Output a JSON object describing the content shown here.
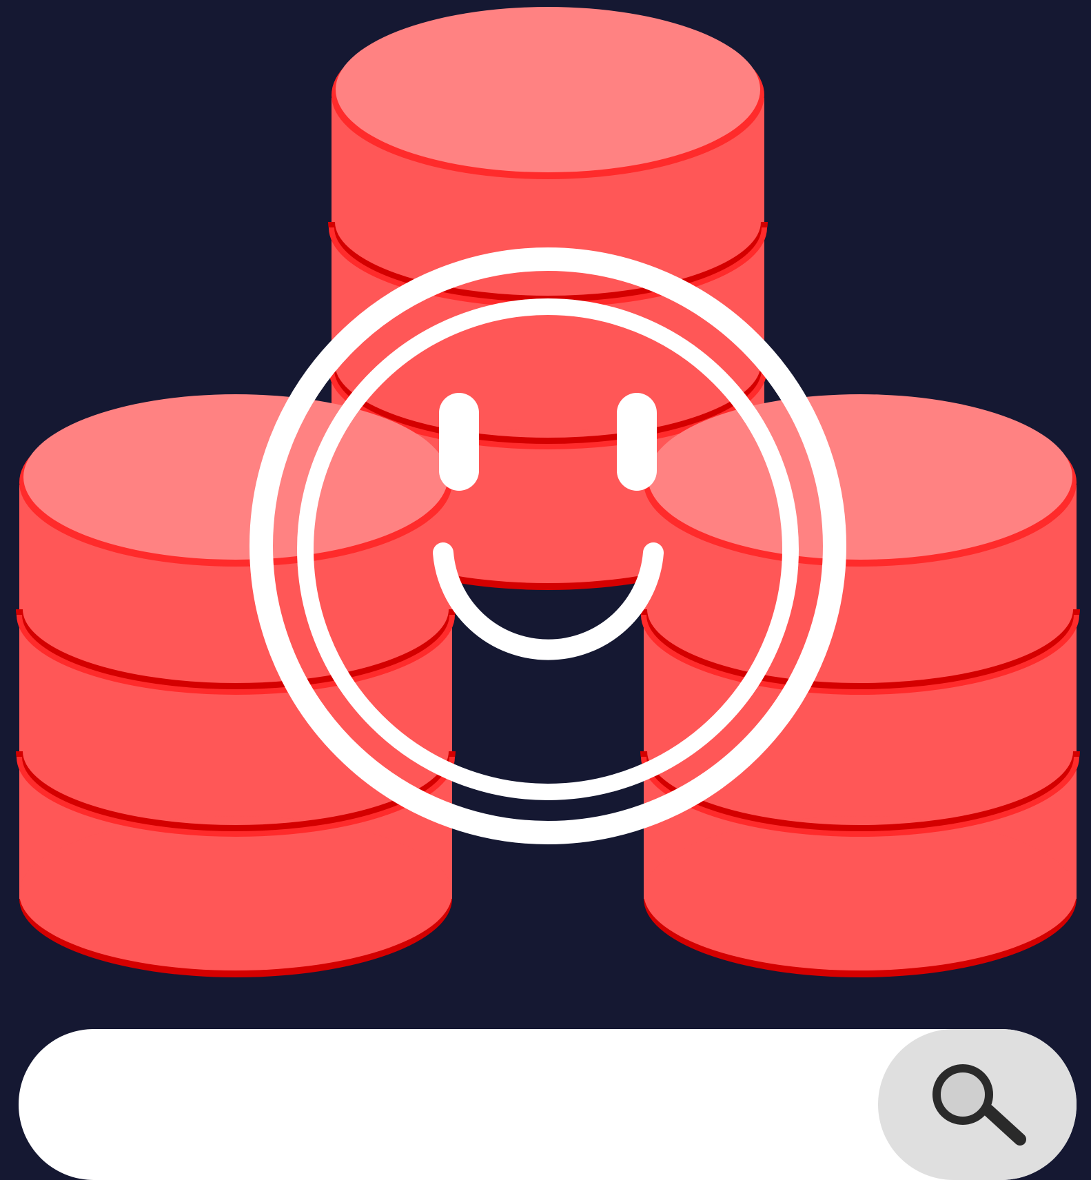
{
  "illustration": {
    "subject": "database-stack-icon",
    "overlay": "smiley-face-icon"
  },
  "search": {
    "value": "",
    "placeholder": ""
  },
  "colors": {
    "background": "#151832",
    "db_body": "#ff5757",
    "db_top": "#ff8282",
    "db_rim": "#ff2b2b",
    "db_shadow": "#d40000",
    "overlay_stroke": "#ffffff",
    "search_bg": "#ffffff",
    "search_button_bg": "#dfdfdf",
    "search_icon_color": "#2a2a2a"
  }
}
